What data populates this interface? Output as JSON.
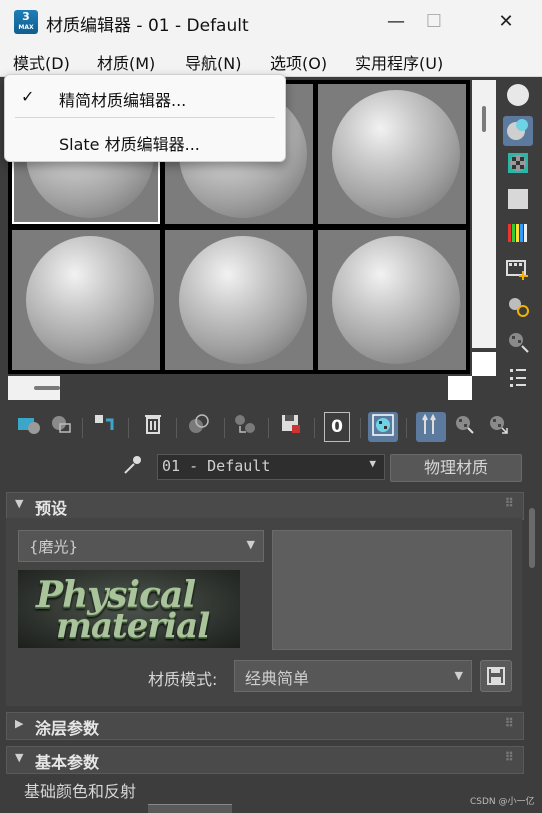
{
  "window": {
    "app_icon_text": "3",
    "app_icon_sub": "MAX",
    "title": "材质编辑器 - 01 - Default",
    "min_icon": "—",
    "max_icon": "☐",
    "close_icon": "✕"
  },
  "menubar": [
    "模式(D)",
    "材质(M)",
    "导航(N)",
    "选项(O)",
    "实用程序(U)"
  ],
  "dropdown": {
    "items": [
      {
        "label": "精简材质编辑器...",
        "checked": true
      },
      {
        "label": "Slate 材质编辑器...",
        "checked": false
      }
    ],
    "check_glyph": "✓"
  },
  "material": {
    "name": "01 - Default",
    "type_button": "物理材质"
  },
  "rollouts": {
    "presets": {
      "title": "预设",
      "preset_value": "{磨光}",
      "image_line1": "Physical",
      "image_line2": "material",
      "mode_label": "材质模式:",
      "mode_value": "经典简单"
    },
    "coating": {
      "title": "涂层参数"
    },
    "basic": {
      "title": "基本参数",
      "sub_label": "基础颜色和反射"
    }
  },
  "watermark": "CSDN @小一亿",
  "toolbar": {
    "zero_label": "0"
  }
}
